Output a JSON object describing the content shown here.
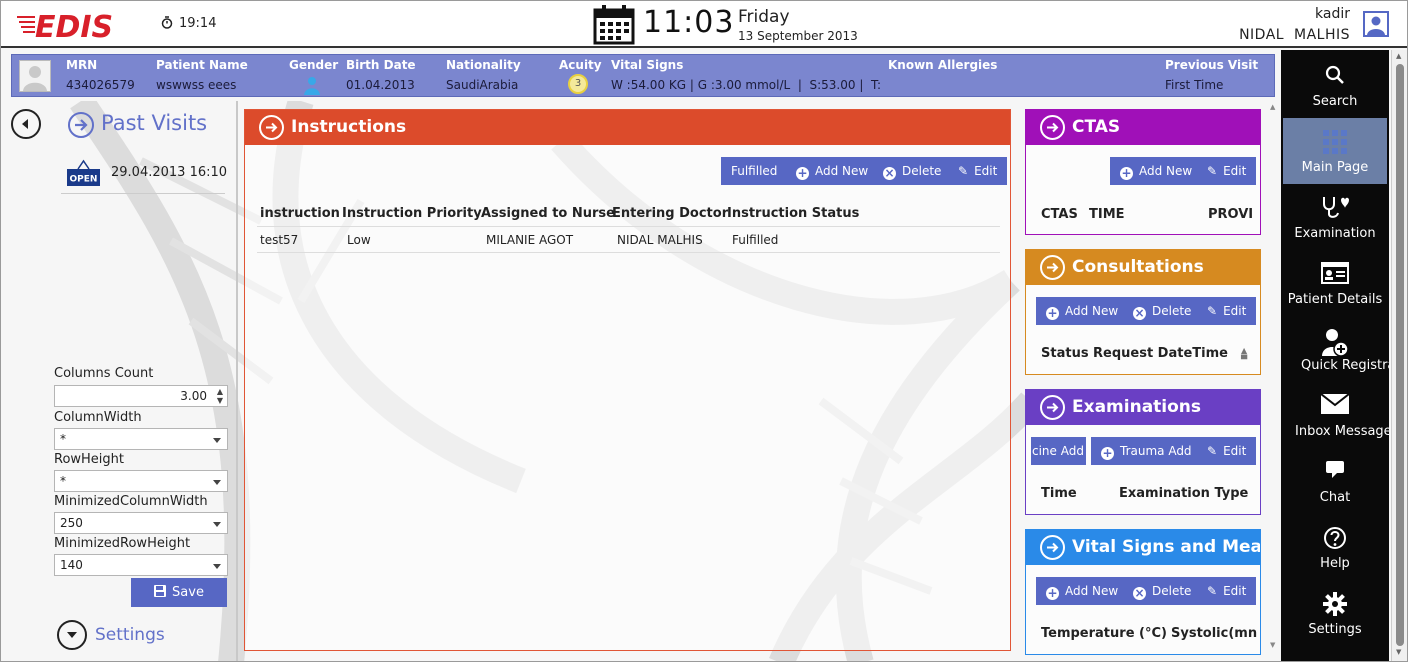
{
  "app": {
    "logo_text": "EDIS",
    "small_clock": "19:14",
    "time": "11:03",
    "day": "Friday",
    "date": "13 September 2013",
    "user_login": "kadir",
    "user_fullname": "NIDAL  MALHIS"
  },
  "patient": {
    "headers": {
      "mrn": "MRN",
      "name": "Patient Name",
      "gender": "Gender",
      "birth": "Birth Date",
      "nationality": "Nationality",
      "acuity": "Acuity",
      "vitals": "Vital Signs",
      "allergies": "Known Allergies",
      "previous": "Previous Visit"
    },
    "mrn": "434026579",
    "name": "wswwss eees",
    "birth": "01.04.2013",
    "nationality": "SaudiArabia",
    "acuity": "3",
    "vitals": "W :54.00 KG | G :3.00 mmol/L  |  S:53.00 |  T:",
    "allergies": "",
    "previous": "First Time"
  },
  "nav": [
    {
      "label": "Search",
      "icon": "search-icon"
    },
    {
      "label": "Main Page",
      "icon": "grid-icon"
    },
    {
      "label": "Examination",
      "icon": "stethoscope-icon"
    },
    {
      "label": "Patient Details",
      "icon": "id-card-icon"
    },
    {
      "label": "Quick Registration",
      "icon": "add-user-icon"
    },
    {
      "label": "Inbox Messages",
      "icon": "envelope-icon"
    },
    {
      "label": "Chat",
      "icon": "chat-icon"
    },
    {
      "label": "Help",
      "icon": "help-icon"
    },
    {
      "label": "Settings",
      "icon": "gear-icon"
    }
  ],
  "left": {
    "title": "Past Visits",
    "badge": "OPEN",
    "visit_date": "29.04.2013 16:10",
    "fields": {
      "columns_count_label": "Columns Count",
      "columns_count": "3.00",
      "column_width_label": "ColumnWidth",
      "column_width": "*",
      "row_height_label": "RowHeight",
      "row_height": "*",
      "min_col_width_label": "MinimizedColumnWidth",
      "min_col_width": "250",
      "min_row_height_label": "MinimizedRowHeight",
      "min_row_height": "140"
    },
    "save": "Save",
    "settings": "Settings"
  },
  "instructions": {
    "title": "Instructions",
    "buttons": {
      "fulfilled": "Fulfilled",
      "add": "Add New",
      "delete": "Delete",
      "edit": "Edit"
    },
    "columns": [
      "instruction",
      "Instruction Priority",
      "Assigned to Nurse",
      "Entering Doctor",
      "Instruction Status"
    ],
    "rows": [
      [
        "test57",
        "Low",
        "MILANIE  AGOT",
        "NIDAL  MALHIS",
        "Fulfilled"
      ]
    ]
  },
  "panels": {
    "ctas": {
      "title": "CTAS",
      "color": "#a010b8",
      "add": "Add New",
      "edit": "Edit",
      "cols": [
        "CTAS",
        "TIME",
        "PROVI"
      ]
    },
    "consultations": {
      "title": "Consultations",
      "color": "#d68a20",
      "add": "Add New",
      "delete": "Delete",
      "edit": "Edit",
      "cols": [
        "Status",
        "Request DateTime"
      ]
    },
    "examinations": {
      "title": "Examinations",
      "color": "#6a3fc4",
      "cine": "cine Add",
      "trauma": "Trauma Add",
      "edit": "Edit",
      "cols": [
        "Time",
        "Examination Type"
      ]
    },
    "vitals": {
      "title": "Vital Signs and Meas",
      "color": "#2a8ae8",
      "add": "Add New",
      "delete": "Delete",
      "edit": "Edit",
      "cols": [
        "Temperature (°C)",
        "Systolic(mn"
      ]
    }
  }
}
